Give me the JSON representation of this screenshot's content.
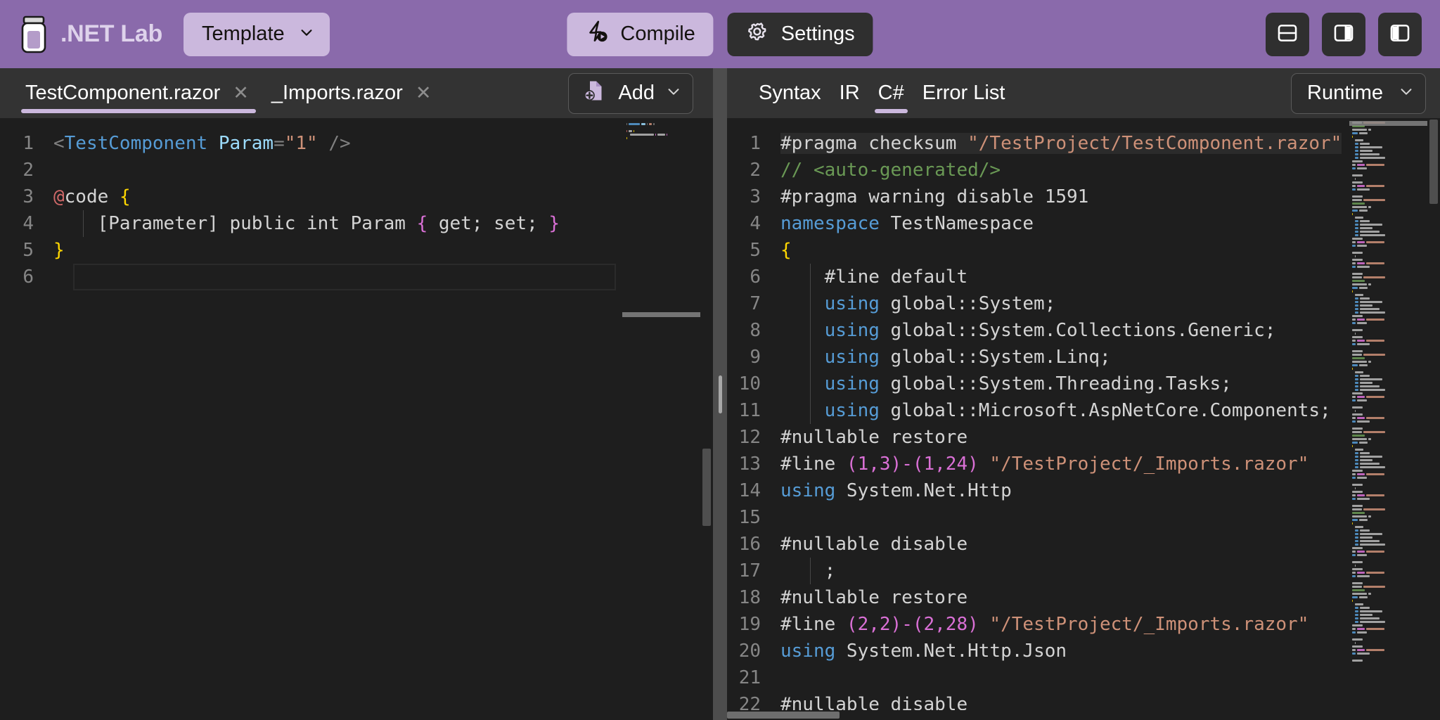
{
  "header": {
    "logo_icon": "jar-icon",
    "title": ".NET Lab",
    "template_label": "Template",
    "template_chevron_icon": "chevron-down-icon",
    "compile_label": "Compile",
    "compile_icon": "lightning-run-icon",
    "settings_label": "Settings",
    "settings_icon": "gear-icon",
    "layout_buttons": [
      {
        "name": "layout-horizontal-split",
        "icon": "split-horizontal-icon"
      },
      {
        "name": "layout-vertical-split-right",
        "icon": "split-vertical-right-icon"
      },
      {
        "name": "layout-vertical-split-left",
        "icon": "split-vertical-left-icon"
      }
    ],
    "bg_color": "#8a6aab",
    "accent_color": "#cbb8dd"
  },
  "left_panel": {
    "tabs": [
      {
        "label": "TestComponent.razor",
        "active": true,
        "close_icon": "close-icon"
      },
      {
        "label": "_Imports.razor",
        "active": false,
        "close_icon": "close-icon"
      }
    ],
    "add_button": {
      "label": "Add",
      "icon": "file-add-icon",
      "chevron_icon": "chevron-down-icon"
    },
    "editor": {
      "language": "razor",
      "current_line": 6,
      "lines": [
        {
          "n": "1",
          "tokens": [
            {
              "t": "<",
              "c": "t-punc"
            },
            {
              "t": "TestComponent",
              "c": "t-tag"
            },
            {
              "t": " ",
              "c": "t-plain"
            },
            {
              "t": "Param",
              "c": "t-attr"
            },
            {
              "t": "=",
              "c": "t-punc"
            },
            {
              "t": "\"1\"",
              "c": "t-str"
            },
            {
              "t": " ",
              "c": "t-plain"
            },
            {
              "t": "/>",
              "c": "t-punc"
            }
          ]
        },
        {
          "n": "2",
          "tokens": []
        },
        {
          "n": "3",
          "tokens": [
            {
              "t": "@",
              "c": "t-razor"
            },
            {
              "t": "code ",
              "c": "t-plain"
            },
            {
              "t": "{",
              "c": "t-brace1"
            }
          ]
        },
        {
          "n": "4",
          "indent": true,
          "tokens": [
            {
              "t": "    [Parameter] public int Param ",
              "c": "t-plain"
            },
            {
              "t": "{",
              "c": "t-brace2"
            },
            {
              "t": " get; set; ",
              "c": "t-plain"
            },
            {
              "t": "}",
              "c": "t-brace2"
            }
          ]
        },
        {
          "n": "5",
          "tokens": [
            {
              "t": "}",
              "c": "t-brace1"
            }
          ]
        },
        {
          "n": "6",
          "tokens": []
        }
      ]
    }
  },
  "right_panel": {
    "tabs": [
      {
        "label": "Syntax",
        "active": false
      },
      {
        "label": "IR",
        "active": false
      },
      {
        "label": "C#",
        "active": true
      },
      {
        "label": "Error List",
        "active": false
      }
    ],
    "runtime_button": {
      "label": "Runtime",
      "chevron_icon": "chevron-down-icon"
    },
    "editor": {
      "language": "csharp",
      "highlighted_line": 1,
      "lines": [
        {
          "n": "1",
          "hl": true,
          "tokens": [
            {
              "t": "#pragma checksum ",
              "c": "t-plain"
            },
            {
              "t": "\"/TestProject/TestComponent.razor\"",
              "c": "t-str"
            }
          ]
        },
        {
          "n": "2",
          "tokens": [
            {
              "t": "// <auto-generated/>",
              "c": "t-comment"
            }
          ]
        },
        {
          "n": "3",
          "tokens": [
            {
              "t": "#pragma warning disable ",
              "c": "t-plain"
            },
            {
              "t": "1591",
              "c": "t-plain"
            }
          ]
        },
        {
          "n": "4",
          "tokens": [
            {
              "t": "namespace",
              "c": "t-kw"
            },
            {
              "t": " TestNamespace",
              "c": "t-plain"
            }
          ]
        },
        {
          "n": "5",
          "tokens": [
            {
              "t": "{",
              "c": "t-brace1"
            }
          ]
        },
        {
          "n": "6",
          "indent": true,
          "tokens": [
            {
              "t": "    #line default",
              "c": "t-plain"
            }
          ]
        },
        {
          "n": "7",
          "indent": true,
          "tokens": [
            {
              "t": "    ",
              "c": "t-plain"
            },
            {
              "t": "using",
              "c": "t-kw"
            },
            {
              "t": " global::System;",
              "c": "t-plain"
            }
          ]
        },
        {
          "n": "8",
          "indent": true,
          "tokens": [
            {
              "t": "    ",
              "c": "t-plain"
            },
            {
              "t": "using",
              "c": "t-kw"
            },
            {
              "t": " global::System.Collections.Generic;",
              "c": "t-plain"
            }
          ]
        },
        {
          "n": "9",
          "indent": true,
          "tokens": [
            {
              "t": "    ",
              "c": "t-plain"
            },
            {
              "t": "using",
              "c": "t-kw"
            },
            {
              "t": " global::System.Linq;",
              "c": "t-plain"
            }
          ]
        },
        {
          "n": "10",
          "indent": true,
          "tokens": [
            {
              "t": "    ",
              "c": "t-plain"
            },
            {
              "t": "using",
              "c": "t-kw"
            },
            {
              "t": " global::System.Threading.Tasks;",
              "c": "t-plain"
            }
          ]
        },
        {
          "n": "11",
          "indent": true,
          "tokens": [
            {
              "t": "    ",
              "c": "t-plain"
            },
            {
              "t": "using",
              "c": "t-kw"
            },
            {
              "t": " global::Microsoft.AspNetCore.Components;",
              "c": "t-plain"
            }
          ]
        },
        {
          "n": "12",
          "tokens": [
            {
              "t": "#nullable restore",
              "c": "t-plain"
            }
          ]
        },
        {
          "n": "13",
          "tokens": [
            {
              "t": "#line ",
              "c": "t-plain"
            },
            {
              "t": "(1,3)-(1,24)",
              "c": "t-brace2"
            },
            {
              "t": " ",
              "c": "t-plain"
            },
            {
              "t": "\"/TestProject/_Imports.razor\"",
              "c": "t-str"
            }
          ]
        },
        {
          "n": "14",
          "tokens": [
            {
              "t": "using",
              "c": "t-kw"
            },
            {
              "t": " System.Net.Http",
              "c": "t-plain"
            }
          ]
        },
        {
          "n": "15",
          "tokens": []
        },
        {
          "n": "16",
          "tokens": [
            {
              "t": "#nullable disable",
              "c": "t-plain"
            }
          ]
        },
        {
          "n": "17",
          "indent": true,
          "tokens": [
            {
              "t": "    ;",
              "c": "t-plain"
            }
          ]
        },
        {
          "n": "18",
          "tokens": [
            {
              "t": "#nullable restore",
              "c": "t-plain"
            }
          ]
        },
        {
          "n": "19",
          "tokens": [
            {
              "t": "#line ",
              "c": "t-plain"
            },
            {
              "t": "(2,2)-(2,28)",
              "c": "t-brace2"
            },
            {
              "t": " ",
              "c": "t-plain"
            },
            {
              "t": "\"/TestProject/_Imports.razor\"",
              "c": "t-str"
            }
          ]
        },
        {
          "n": "20",
          "tokens": [
            {
              "t": "using",
              "c": "t-kw"
            },
            {
              "t": " System.Net.Http.Json",
              "c": "t-plain"
            }
          ]
        },
        {
          "n": "21",
          "tokens": []
        },
        {
          "n": "22",
          "tokens": [
            {
              "t": "#nullable disable",
              "c": "t-plain"
            }
          ]
        }
      ]
    }
  },
  "splitter": {
    "name": "pane-splitter"
  }
}
